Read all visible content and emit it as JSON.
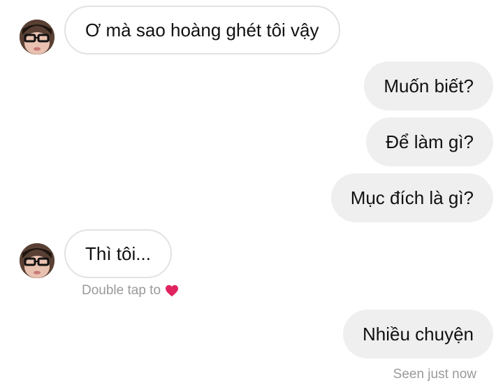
{
  "conversation": {
    "messages": [
      {
        "sender": "other",
        "text": "Ơ mà sao hoàng ghét tôi vậy"
      },
      {
        "sender": "me",
        "text": "Muốn biết?"
      },
      {
        "sender": "me",
        "text": "Để làm gì?"
      },
      {
        "sender": "me",
        "text": "Mục đích là gì?"
      },
      {
        "sender": "other",
        "text": "Thì tôi..."
      },
      {
        "sender": "me",
        "text": "Nhiều chuyện"
      }
    ],
    "double_tap_hint": "Double tap to",
    "double_tap_icon": "heart-icon",
    "seen_status": "Seen just now"
  },
  "colors": {
    "outgoing_bubble": "#efefef",
    "incoming_border": "#e2e2e2",
    "meta_text": "#9a9a9a",
    "heart": "#e0245e"
  }
}
